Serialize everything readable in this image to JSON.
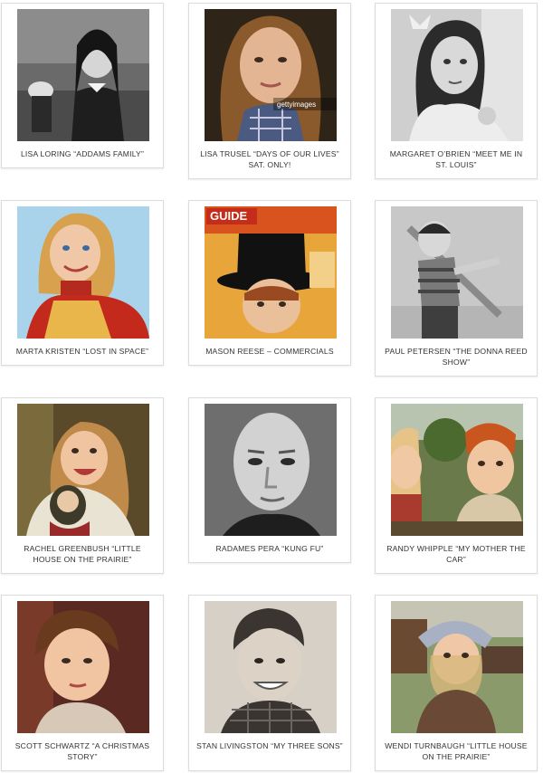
{
  "cards": [
    {
      "caption": "LISA LORING “ADDAMS FAMILY”",
      "photo": "lisa-loring-photo"
    },
    {
      "caption": "LISA TRUSEL “DAYS OF OUR LIVES” SAT. ONLY!",
      "photo": "lisa-trusel-photo"
    },
    {
      "caption": "MARGARET O’BRIEN “MEET ME IN ST. LOUIS”",
      "photo": "margaret-obrien-photo"
    },
    {
      "caption": "MARTA KRISTEN “LOST IN SPACE”",
      "photo": "marta-kristen-photo"
    },
    {
      "caption": "MASON REESE – COMMERCIALS",
      "photo": "mason-reese-photo"
    },
    {
      "caption": "PAUL PETERSEN “THE DONNA REED SHOW”",
      "photo": "paul-petersen-photo"
    },
    {
      "caption": "RACHEL GREENBUSH “LITTLE HOUSE ON THE PRAIRIE”",
      "photo": "rachel-greenbush-photo"
    },
    {
      "caption": "RADAMES PERA “KUNG FU”",
      "photo": "radames-pera-photo"
    },
    {
      "caption": "RANDY WHIPPLE “MY MOTHER THE CAR”",
      "photo": "randy-whipple-photo"
    },
    {
      "caption": "SCOTT SCHWARTZ “A CHRISTMAS STORY”",
      "photo": "scott-schwartz-photo"
    },
    {
      "caption": "STAN LIVINGSTON “MY THREE SONS”",
      "photo": "stan-livingston-photo"
    },
    {
      "caption": "WENDI TURNBAUGH “LITTLE HOUSE ON THE PRAIRIE”",
      "photo": "wendi-turnbaugh-photo"
    }
  ],
  "photo_text": {
    "getty": "gettyimages",
    "guide": "GUIDE"
  }
}
